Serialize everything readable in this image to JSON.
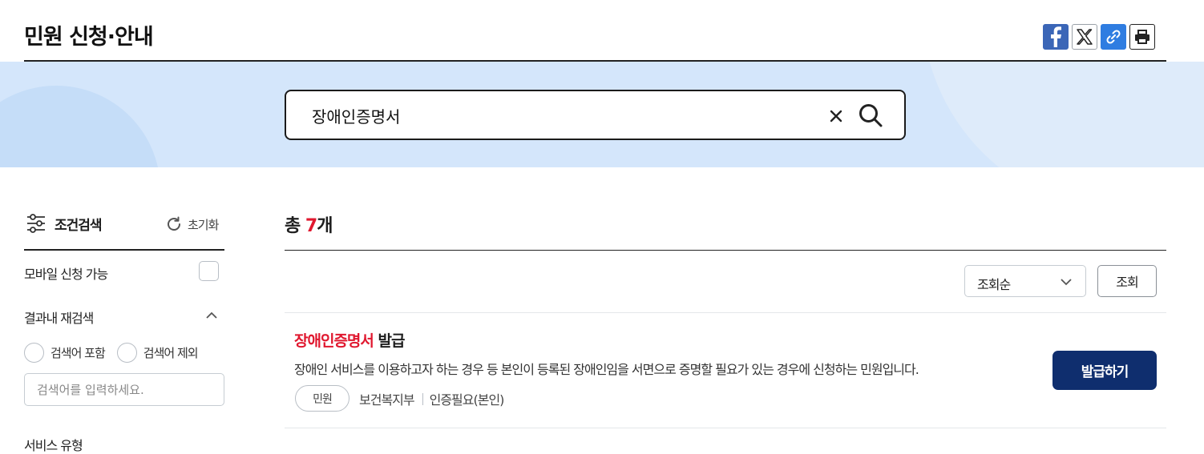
{
  "header": {
    "title": "민원 신청·안내",
    "share": {
      "facebook_icon": "facebook-icon",
      "x_icon": "x-twitter-icon",
      "link_icon": "link-icon",
      "print_icon": "print-icon"
    }
  },
  "search": {
    "value": "장애인증명서",
    "clear_icon": "close-icon",
    "search_icon": "search-icon"
  },
  "sidebar": {
    "filter_title": "조건검색",
    "reset_label": "초기화",
    "mobile_label": "모바일 신청 가능",
    "refine_label": "결과내 재검색",
    "radio_include": "검색어 포함",
    "radio_exclude": "검색어 제외",
    "refine_placeholder": "검색어를 입력하세요.",
    "next_section": "서비스 유형"
  },
  "results": {
    "total_prefix": "총 ",
    "total_count": "7",
    "total_suffix": "개",
    "sort_value": "조회순",
    "view_button": "조회",
    "items": [
      {
        "title_highlight": "장애인증명서",
        "title_rest": " 발급",
        "description": "장애인 서비스를 이용하고자 하는 경우 등 본인이 등록된 장애인임을 서면으로 증명할 필요가 있는 경우에 신청하는 민원입니다.",
        "tag": "민원",
        "agency": "보건복지부",
        "auth": "인증필요(본인)",
        "action": "발급하기"
      }
    ]
  },
  "colors": {
    "accent_red": "#e0182f",
    "primary_navy": "#0f2e6e",
    "band_blue": "#d4e6fb"
  }
}
